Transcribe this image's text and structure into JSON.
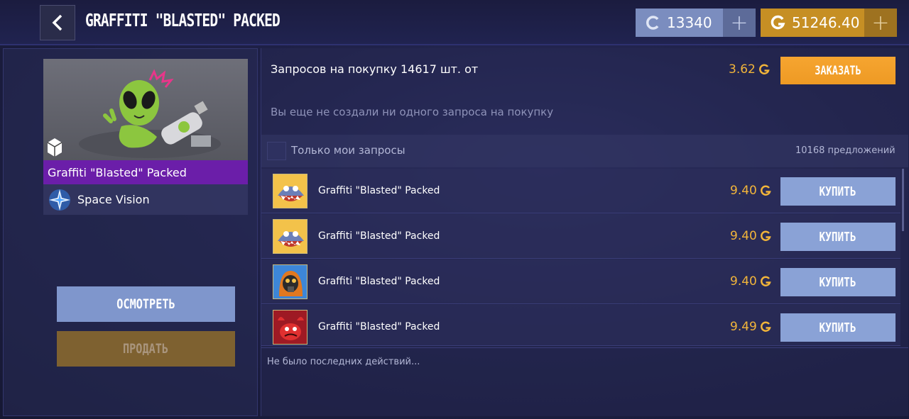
{
  "header": {
    "title": "GRAFFITI \"BLASTED\" PACKED",
    "silver_balance": "13340",
    "gold_balance": "51246.40"
  },
  "item": {
    "name": "Graffiti \"Blasted\" Packed",
    "collection": "Space Vision",
    "inspect_label": "ОСМОТРЕТЬ",
    "sell_label": "ПРОДАТЬ"
  },
  "orders": {
    "summary": "Запросов на покупку 14617 шт. от",
    "price": "3.62",
    "order_label": "ЗАКАЗАТЬ",
    "empty_text": "Вы еще не создали ни одного запроса на покупку"
  },
  "filter": {
    "only_mine_label": "Только мои запросы",
    "offers_count": "10168 предложений"
  },
  "listings": [
    {
      "name": "Graffiti \"Blasted\" Packed",
      "price": "9.40",
      "buy_label": "КУПИТЬ",
      "icon": "shark-monster-icon"
    },
    {
      "name": "Graffiti \"Blasted\" Packed",
      "price": "9.40",
      "buy_label": "КУПИТЬ",
      "icon": "shark-monster-icon"
    },
    {
      "name": "Graffiti \"Blasted\" Packed",
      "price": "9.40",
      "buy_label": "КУПИТЬ",
      "icon": "gasmask-hood-icon"
    },
    {
      "name": "Graffiti \"Blasted\" Packed",
      "price": "9.49",
      "buy_label": "КУПИТЬ",
      "icon": "red-crab-icon"
    }
  ],
  "recent_activity": "Не было последних действий...",
  "colors": {
    "gold": "#f2b53a",
    "silver_bg": "#7b8dbf",
    "gold_bg": "#c68f24",
    "rarity_purple": "#6b1ea9",
    "order_button": "#f6a530",
    "buy_button": "#8aa2d6"
  }
}
